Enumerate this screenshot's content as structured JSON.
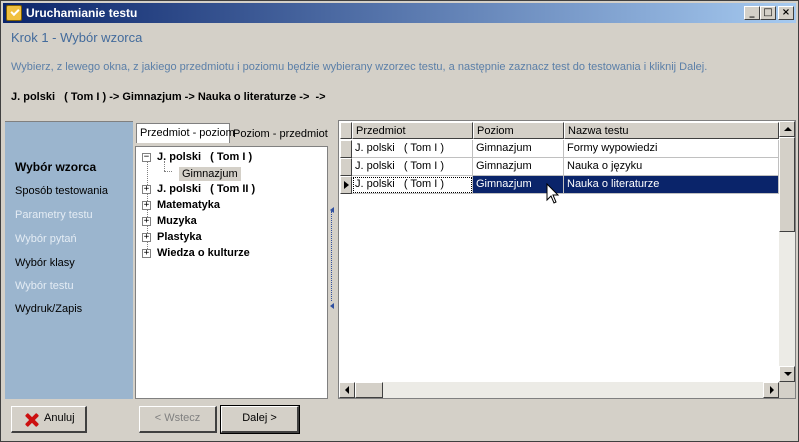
{
  "window": {
    "title": "Uruchamianie testu"
  },
  "titlebar": {
    "min": "_",
    "max": "□",
    "close": "×"
  },
  "header": {
    "step_title": "Krok 1 - Wybór wzorca",
    "instructions": "Wybierz, z lewego okna, z jakiego przedmiotu i poziomu będzie wybierany wzorzec testu, a następnie zaznacz test do testowania i kliknij Dalej.",
    "path": "J. polski   ( Tom I ) -> Gimnazjum -> Nauka o literaturze ->  ->"
  },
  "steps": [
    {
      "label": "Wybór wzorca",
      "state": "active"
    },
    {
      "label": "Sposób testowania",
      "state": "enabled"
    },
    {
      "label": "Parametry testu",
      "state": "disabled"
    },
    {
      "label": "Wybór pytań",
      "state": "disabled"
    },
    {
      "label": "Wybór klasy",
      "state": "enabled"
    },
    {
      "label": "Wybór testu",
      "state": "disabled"
    },
    {
      "label": "Wydruk/Zapis",
      "state": "enabled"
    }
  ],
  "tabs": [
    {
      "label": "Przedmiot - poziom",
      "active": true
    },
    {
      "label": "Poziom - przedmiot",
      "active": false
    }
  ],
  "tree": {
    "items": [
      {
        "label": "J. polski   ( Tom I )",
        "expanded": true,
        "children": [
          "Gimnazjum"
        ]
      },
      {
        "label": "J. polski   ( Tom II )",
        "expanded": false
      },
      {
        "label": "Matematyka",
        "expanded": false
      },
      {
        "label": "Muzyka",
        "expanded": false
      },
      {
        "label": "Plastyka",
        "expanded": false
      },
      {
        "label": "Wiedza o kulturze",
        "expanded": false
      }
    ],
    "expand_glyph": "+",
    "collapse_glyph": "−"
  },
  "grid": {
    "columns": [
      "Przedmiot",
      "Poziom",
      "Nazwa testu"
    ],
    "rows": [
      {
        "cells": [
          "J. polski   ( Tom I )",
          "Gimnazjum",
          "Formy wypowiedzi"
        ],
        "selected": false
      },
      {
        "cells": [
          "J. polski   ( Tom I )",
          "Gimnazjum",
          "Nauka o języku"
        ],
        "selected": false
      },
      {
        "cells": [
          "J. polski   ( Tom I )",
          "Gimnazjum",
          "Nauka o literaturze"
        ],
        "selected": true
      }
    ]
  },
  "buttons": {
    "cancel": "Anuluj",
    "back": "< Wstecz",
    "next": "Dalej >"
  },
  "colors": {
    "title_gradient_start": "#0a246a",
    "selection": "#0a246a",
    "step_panel": "#9bb5ce",
    "step_title": "#436b9c"
  }
}
